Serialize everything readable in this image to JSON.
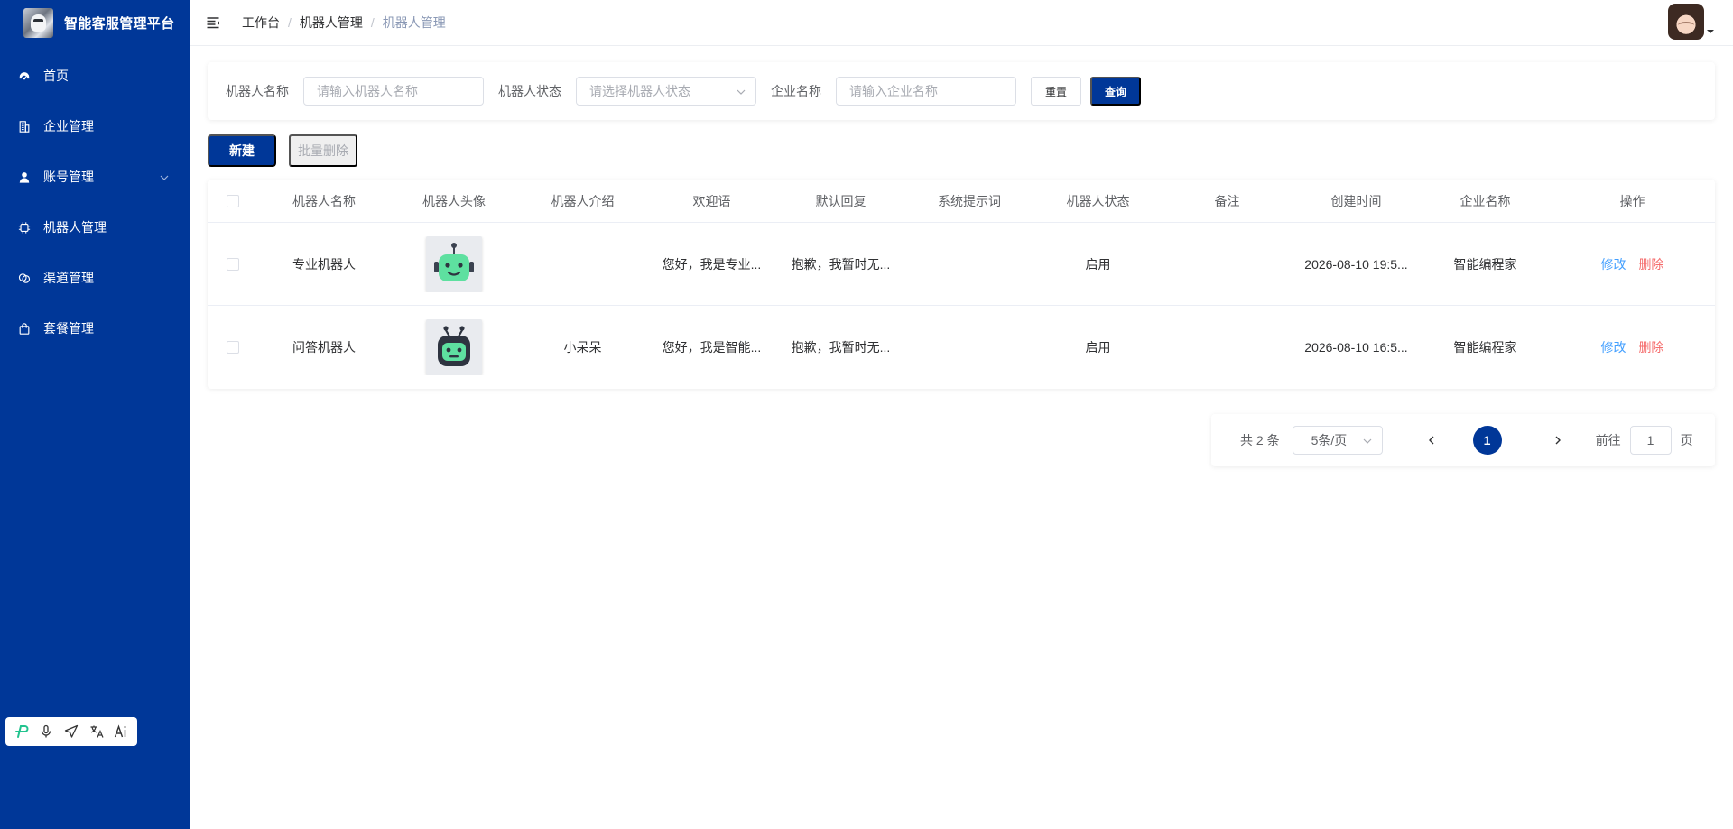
{
  "app": {
    "title": "智能客服管理平台"
  },
  "sidebar": {
    "items": [
      {
        "label": "首页",
        "icon": "dashboard-icon"
      },
      {
        "label": "企业管理",
        "icon": "building-icon"
      },
      {
        "label": "账号管理",
        "icon": "user-icon",
        "expandable": true
      },
      {
        "label": "机器人管理",
        "icon": "chip-icon"
      },
      {
        "label": "渠道管理",
        "icon": "channel-icon"
      },
      {
        "label": "套餐管理",
        "icon": "bag-icon"
      }
    ]
  },
  "header": {
    "breadcrumb": [
      "工作台",
      "机器人管理",
      "机器人管理"
    ]
  },
  "search": {
    "name_label": "机器人名称",
    "name_placeholder": "请输入机器人名称",
    "status_label": "机器人状态",
    "status_placeholder": "请选择机器人状态",
    "company_label": "企业名称",
    "company_placeholder": "请输入企业名称",
    "reset_label": "重置",
    "query_label": "查询"
  },
  "actions": {
    "new_label": "新建",
    "batch_delete_label": "批量删除"
  },
  "table": {
    "columns": [
      "机器人名称",
      "机器人头像",
      "机器人介绍",
      "欢迎语",
      "默认回复",
      "系统提示词",
      "机器人状态",
      "备注",
      "创建时间",
      "企业名称",
      "操作"
    ],
    "rows": [
      {
        "name": "专业机器人",
        "avatar": "robot-avatar-green",
        "intro": "",
        "welcome": "您好，我是专业...",
        "default_reply": "抱歉，我暂时无...",
        "system_prompt": "",
        "status": "启用",
        "remark": "",
        "created": "2026-08-10 19:5...",
        "company": "智能编程家",
        "edit": "修改",
        "delete": "删除"
      },
      {
        "name": "问答机器人",
        "avatar": "robot-avatar-dark",
        "intro": "小呆呆",
        "welcome": "您好，我是智能...",
        "default_reply": "抱歉，我暂时无...",
        "system_prompt": "",
        "status": "启用",
        "remark": "",
        "created": "2026-08-10 16:5...",
        "company": "智能编程家",
        "edit": "修改",
        "delete": "删除"
      }
    ]
  },
  "pagination": {
    "total": "共 2 条",
    "page_size": "5条/页",
    "current": "1",
    "goto_label": "前往",
    "goto_value": "1",
    "page_suffix": "页"
  },
  "colors": {
    "primary": "#003798",
    "link": "#409eff",
    "danger": "#f56c6c",
    "robot_green": "#5ee0a0"
  }
}
